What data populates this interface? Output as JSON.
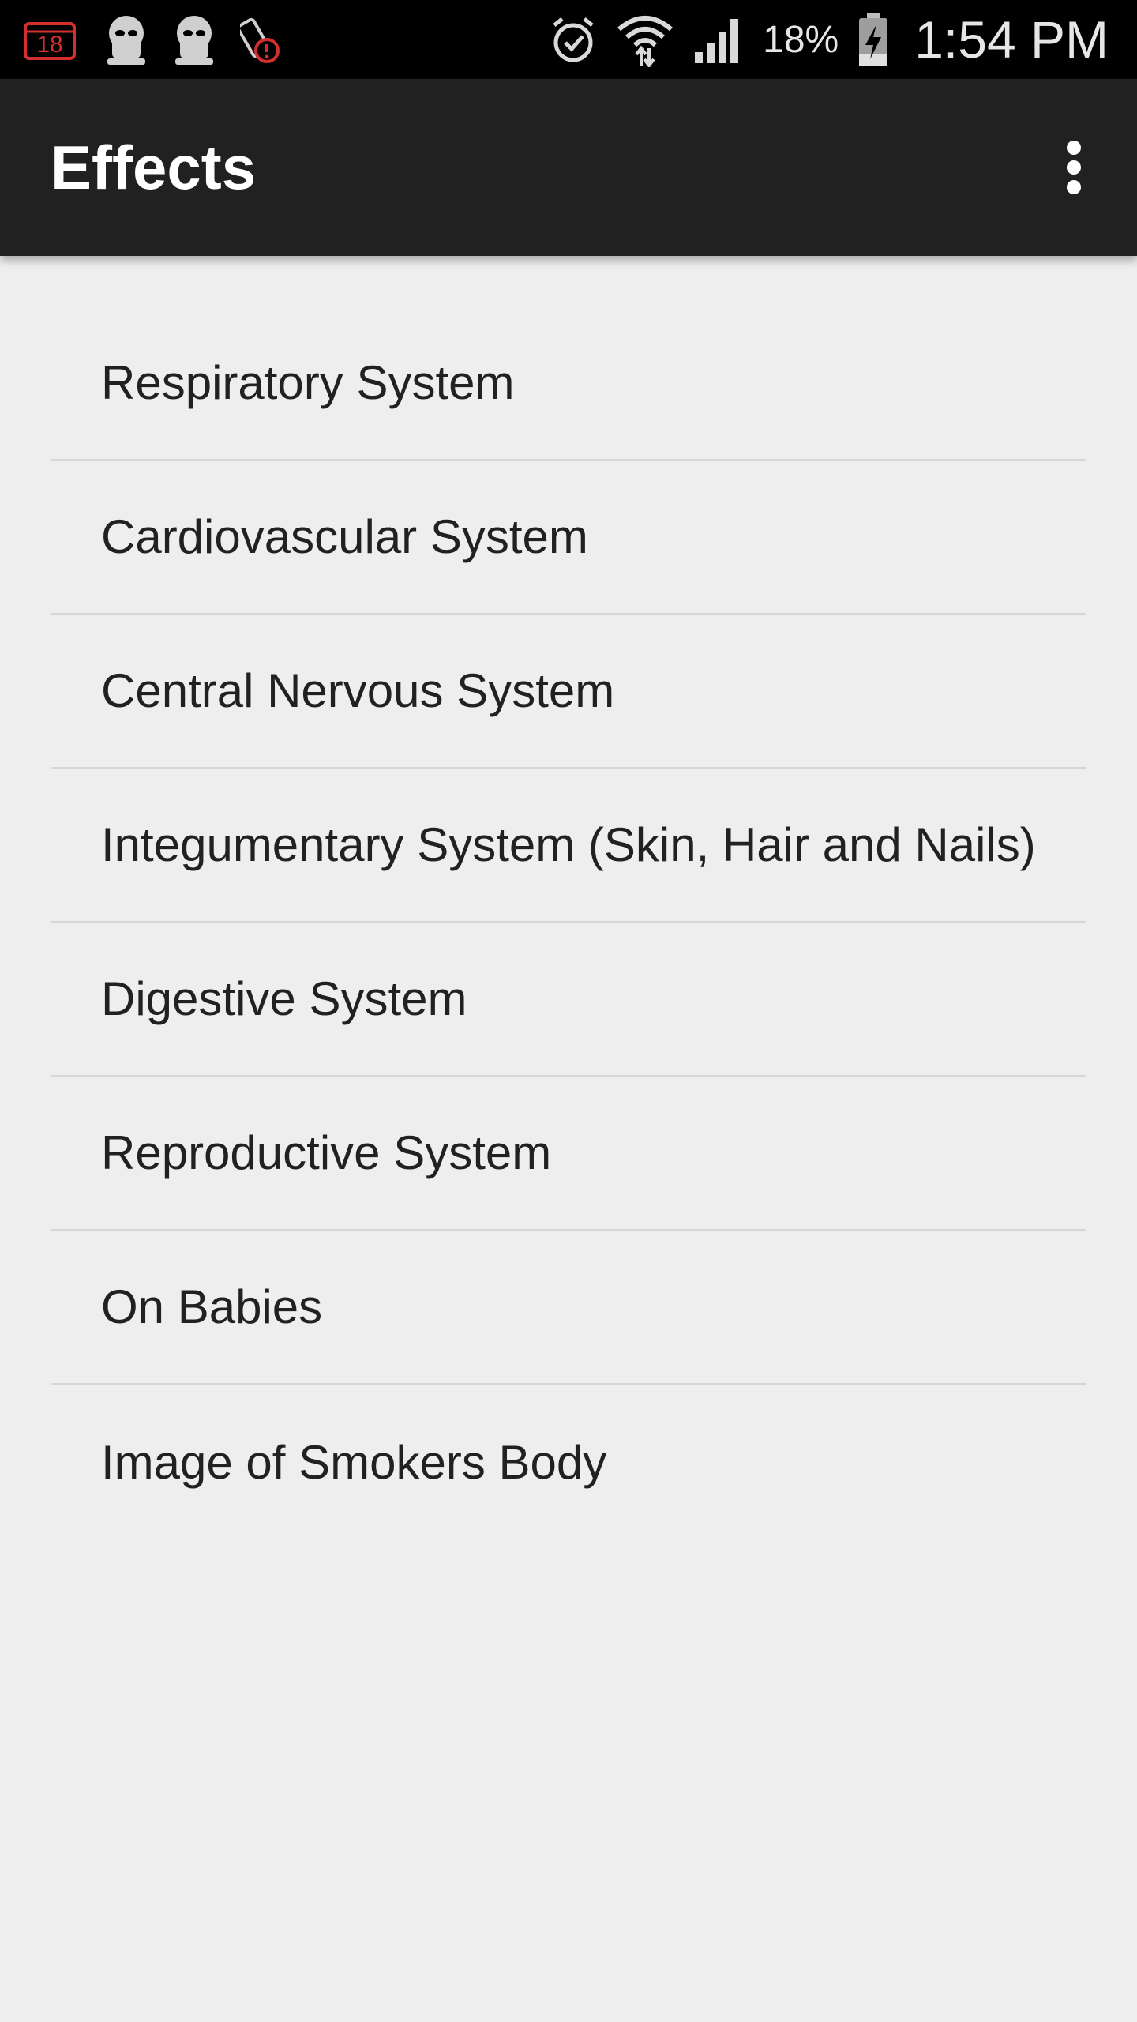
{
  "status_bar": {
    "notification_badge": "18",
    "battery_percent": "18%",
    "time": "1:54 PM",
    "left_icons": [
      "calendar-icon",
      "alien-icon",
      "alien-icon",
      "cigarette-alert-icon"
    ],
    "right_icons": [
      "alarm-icon",
      "wifi-icon",
      "signal-icon",
      "battery-charging-icon"
    ]
  },
  "app_bar": {
    "title": "Effects",
    "menu_icon": "more-vert-icon"
  },
  "list": {
    "items": [
      {
        "label": "Respiratory System"
      },
      {
        "label": "Cardiovascular System"
      },
      {
        "label": "Central Nervous System"
      },
      {
        "label": "Integumentary System (Skin, Hair and Nails)"
      },
      {
        "label": "Digestive System"
      },
      {
        "label": "Reproductive System"
      },
      {
        "label": "On Babies"
      },
      {
        "label": "Image of Smokers Body"
      }
    ]
  },
  "colors": {
    "status_bar_bg": "#000000",
    "app_bar_bg": "#212121",
    "page_bg": "#eeeeee",
    "divider": "#d6d6d6",
    "text_primary": "#212121",
    "badge_red": "#d32f2f"
  }
}
